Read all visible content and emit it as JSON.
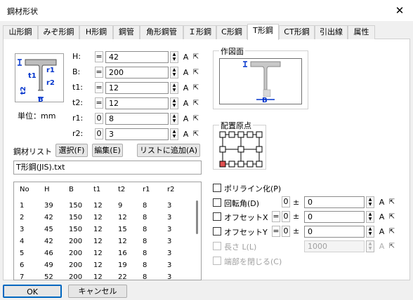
{
  "window": {
    "title": "鋼材形状",
    "close_glyph": "✕"
  },
  "tabs": [
    "山形鋼",
    "みぞ形鋼",
    "H形鋼",
    "鋼管",
    "角形鋼管",
    "Ｉ形鋼",
    "C形鋼",
    "T形鋼",
    "CT形鋼",
    "引出線",
    "属性"
  ],
  "active_tab": "T形鋼",
  "shape_unit": "単位：mm",
  "shape_icon_labels": {
    "r1": "r1",
    "r2": "r2",
    "t1": "t1",
    "t2": "t2",
    "B": "B"
  },
  "params": [
    {
      "label": "H:",
      "prefix": "=",
      "value": "42"
    },
    {
      "label": "B:",
      "prefix": "=",
      "value": "200"
    },
    {
      "label": "t1:",
      "prefix": "=",
      "value": "12"
    },
    {
      "label": "t2:",
      "prefix": "=",
      "value": "12"
    },
    {
      "label": "r1:",
      "prefix": "0",
      "value": "8"
    },
    {
      "label": "r2:",
      "prefix": "0",
      "value": "3"
    }
  ],
  "param_buttons": {
    "a": "A",
    "pick": "⇱"
  },
  "steel_list": {
    "label": "鋼材リスト",
    "select_btn": "選択(F)",
    "edit_btn": "編集(E)",
    "add_btn": "リストに追加(A)",
    "file": "T形鋼(JIS).txt",
    "columns": [
      "No",
      "H",
      "B",
      "t1",
      "t2",
      "r1",
      "r2"
    ],
    "rows": [
      [
        "1",
        "39",
        "150",
        "12",
        "9",
        "8",
        "3"
      ],
      [
        "2",
        "42",
        "150",
        "12",
        "12",
        "8",
        "3"
      ],
      [
        "3",
        "45",
        "150",
        "12",
        "15",
        "8",
        "3"
      ],
      [
        "4",
        "42",
        "200",
        "12",
        "12",
        "8",
        "3"
      ],
      [
        "5",
        "46",
        "200",
        "12",
        "16",
        "8",
        "3"
      ],
      [
        "6",
        "49",
        "200",
        "12",
        "19",
        "8",
        "3"
      ],
      [
        "7",
        "52",
        "200",
        "12",
        "22",
        "8",
        "3"
      ]
    ]
  },
  "drawing_view": {
    "label": "作図面"
  },
  "origin": {
    "label": "配置原点"
  },
  "options": {
    "polyline": "ポリライン化(P)",
    "rotate": "回転角(D)",
    "offset_x": "オフセットX",
    "offset_y": "オフセットY",
    "length": "長さ L(L)",
    "close_ends": "端部を閉じる(C)"
  },
  "option_values": {
    "rotate": {
      "pre": "0",
      "pm": "±",
      "value": "0"
    },
    "offset_x": {
      "eq": "=",
      "pre": "0",
      "pm": "±",
      "value": "0"
    },
    "offset_y": {
      "eq": "=",
      "pre": "0",
      "pm": "±",
      "value": "0"
    },
    "length": {
      "value": "1000"
    }
  },
  "footer": {
    "ok": "OK",
    "cancel": "キャンセル"
  }
}
